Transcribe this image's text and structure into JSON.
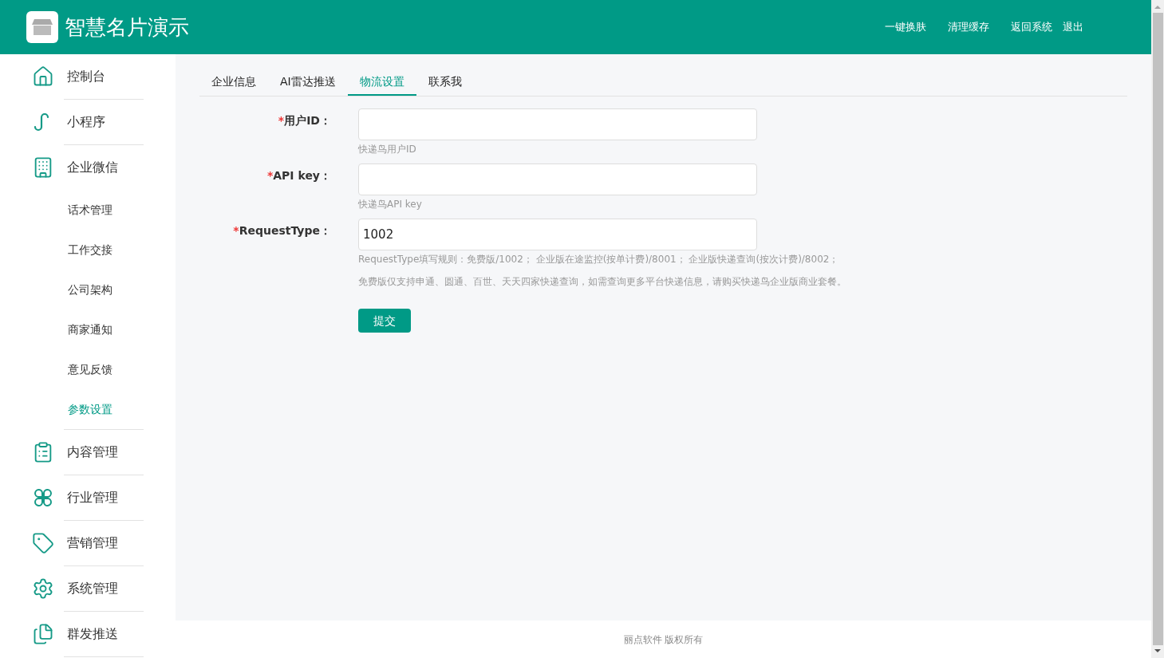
{
  "header": {
    "title": "智慧名片演示",
    "links": [
      "一键换肤",
      "清理缓存",
      "返回系统",
      "退出"
    ]
  },
  "sidebar": {
    "items": [
      {
        "label": "控制台",
        "selected": false
      },
      {
        "label": "小程序",
        "selected": false
      },
      {
        "label": "企业微信",
        "selected": false,
        "expanded": true,
        "children": [
          {
            "label": "话术管理",
            "selected": false
          },
          {
            "label": "工作交接",
            "selected": false
          },
          {
            "label": "公司架构",
            "selected": false
          },
          {
            "label": "商家通知",
            "selected": false
          },
          {
            "label": "意见反馈",
            "selected": false
          },
          {
            "label": "参数设置",
            "selected": true
          }
        ]
      },
      {
        "label": "内容管理",
        "selected": false
      },
      {
        "label": "行业管理",
        "selected": false
      },
      {
        "label": "营销管理",
        "selected": false
      },
      {
        "label": "系统管理",
        "selected": false
      },
      {
        "label": "群发推送",
        "selected": false
      }
    ]
  },
  "tabs": [
    {
      "label": "企业信息",
      "selected": false
    },
    {
      "label": "AI雷达推送",
      "selected": false
    },
    {
      "label": "物流设置",
      "selected": true
    },
    {
      "label": "联系我",
      "selected": false
    }
  ],
  "form": {
    "fields": [
      {
        "mark": "*",
        "label": "用户ID：",
        "help": [
          "快递鸟用户ID"
        ]
      },
      {
        "mark": "*",
        "label": "API key：",
        "help": [
          "快递鸟API key"
        ]
      },
      {
        "mark": "*",
        "label": "RequestType：",
        "value": "1002",
        "help": [
          "RequestType填写规则：免费版/1002； 企业版在途监控(按单计费)/8001； 企业版快递查询(按次计费)/8002；",
          "免费版仅支持申通、圆通、百世、天天四家快递查询，如需查询更多平台快递信息，请购买快递鸟企业版商业套餐。"
        ]
      }
    ],
    "submit": "提交"
  },
  "footer": "丽点软件 版权所有"
}
